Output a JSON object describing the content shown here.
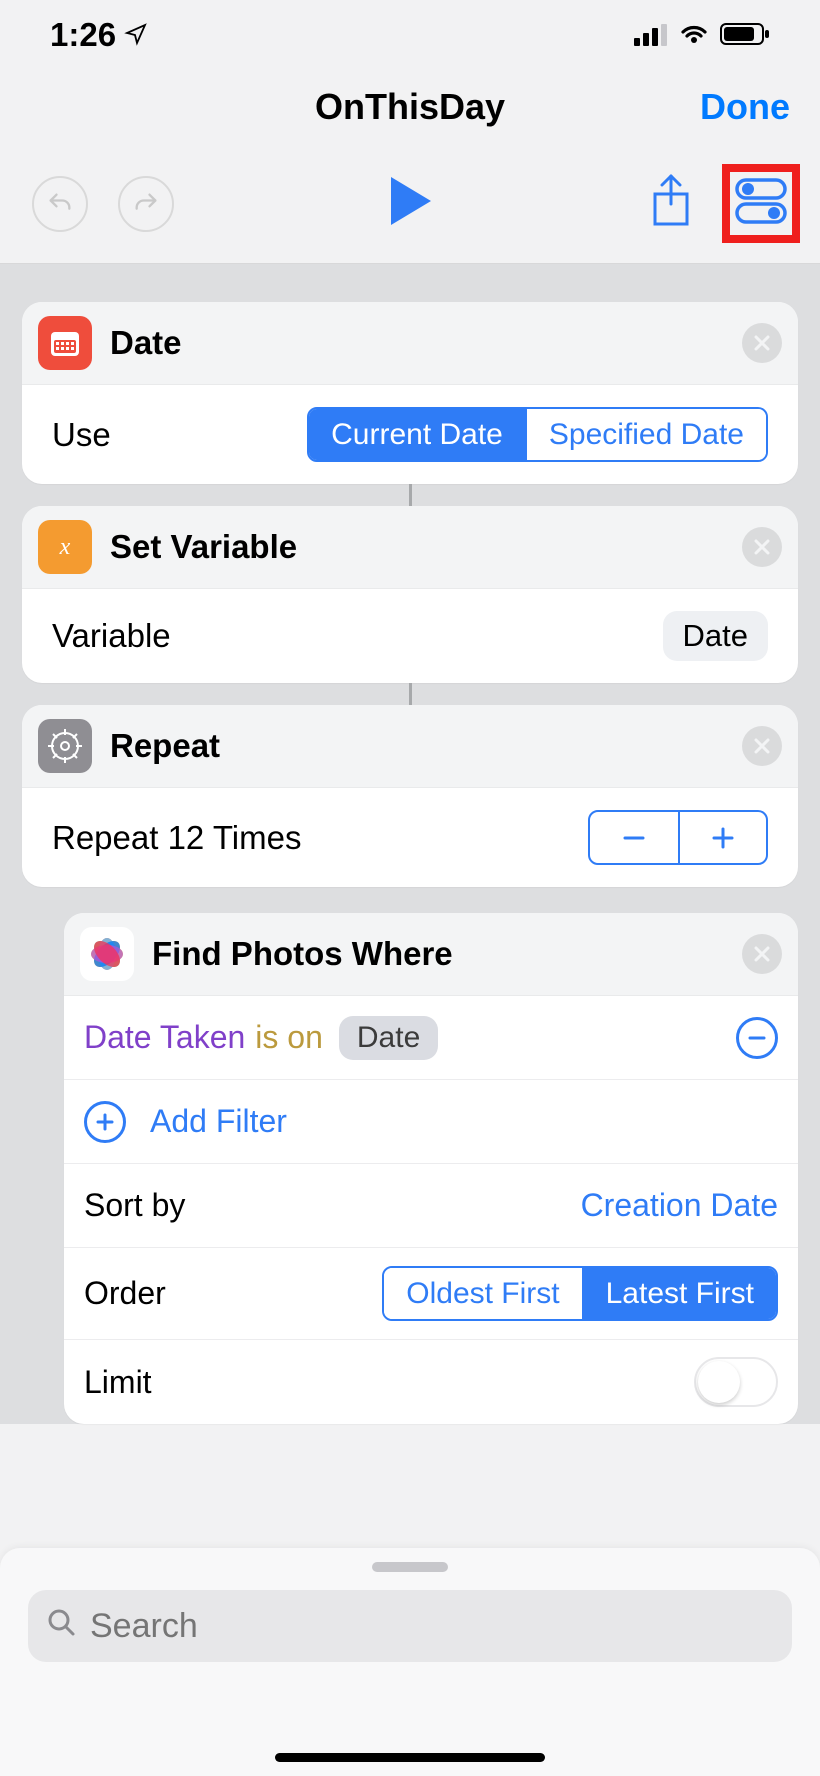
{
  "status": {
    "time": "1:26",
    "location_icon": "location-arrow",
    "signal_icon": "cellular",
    "wifi_icon": "wifi",
    "battery_icon": "battery"
  },
  "header": {
    "title": "OnThisDay",
    "done_label": "Done"
  },
  "toolbar": {
    "undo_icon": "undo",
    "redo_icon": "redo",
    "play_icon": "play",
    "share_icon": "share",
    "settings_icon": "toggles",
    "settings_highlighted": true
  },
  "actions": {
    "date": {
      "icon": "calendar",
      "title": "Date",
      "param_label": "Use",
      "options": [
        "Current Date",
        "Specified Date"
      ],
      "selected_index": 0
    },
    "set_variable": {
      "icon": "variable-x",
      "title": "Set Variable",
      "param_label": "Variable",
      "value": "Date"
    },
    "repeat": {
      "icon": "gear",
      "title": "Repeat",
      "body_text": "Repeat 12 Times",
      "count": 12
    },
    "find_photos": {
      "icon": "photos",
      "title": "Find Photos Where",
      "filter": {
        "field": "Date Taken",
        "operator": "is on",
        "value_chip": "Date"
      },
      "add_filter_label": "Add Filter",
      "sort_by": {
        "label": "Sort by",
        "value": "Creation Date"
      },
      "order": {
        "label": "Order",
        "options": [
          "Oldest First",
          "Latest First"
        ],
        "selected_index": 1
      },
      "limit": {
        "label": "Limit",
        "enabled": false
      }
    }
  },
  "search": {
    "placeholder": "Search"
  },
  "colors": {
    "accent": "#2f7cf6",
    "highlight_border": "#ef1f1d"
  }
}
